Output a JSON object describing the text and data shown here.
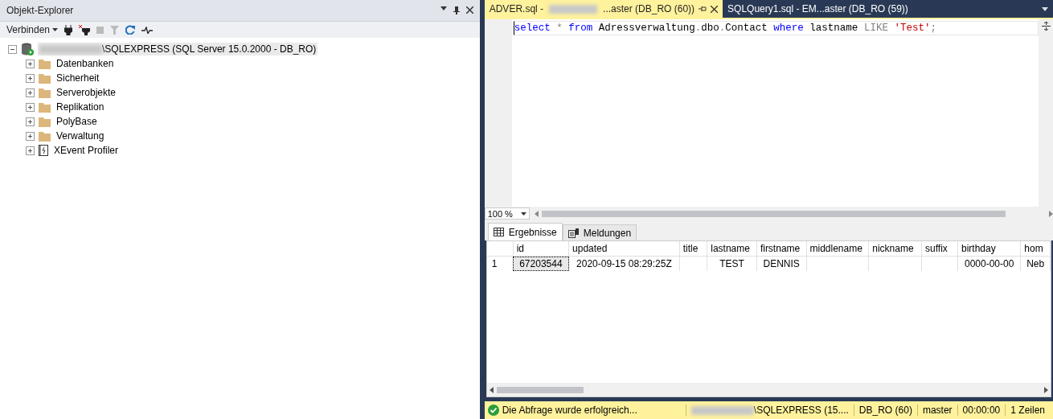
{
  "object_explorer": {
    "title": "Objekt-Explorer",
    "connect_label": "Verbinden",
    "server": {
      "prefix_hidden": true,
      "name": "\\SQLEXPRESS (SQL Server 15.0.2000 - DB_RO)",
      "expanded": true,
      "selected": true,
      "children": [
        {
          "label": "Datenbanken",
          "kind": "folder",
          "expanded": false,
          "selected": false
        },
        {
          "label": "Sicherheit",
          "kind": "folder",
          "expanded": false,
          "selected": false
        },
        {
          "label": "Serverobjekte",
          "kind": "folder",
          "expanded": false,
          "selected": false
        },
        {
          "label": "Replikation",
          "kind": "folder",
          "expanded": false,
          "selected": false
        },
        {
          "label": "PolyBase",
          "kind": "folder",
          "expanded": false,
          "selected": false
        },
        {
          "label": "Verwaltung",
          "kind": "folder",
          "expanded": false,
          "selected": false
        },
        {
          "label": "XEvent Profiler",
          "kind": "profiler",
          "expanded": false,
          "selected": false
        }
      ]
    }
  },
  "editor_tabs": [
    {
      "before": "ADVER.sql -",
      "hidden": true,
      "after": "...aster (DB_RO (60))",
      "selected": true
    },
    {
      "before": "SQLQuery1.sql - EM...aster (DB_RO (59))",
      "hidden": false,
      "selected": false
    }
  ],
  "code": [
    {
      "kind": "keyword",
      "text": "select"
    },
    {
      "kind": "op",
      "text": " * "
    },
    {
      "kind": "keyword",
      "text": "from"
    },
    {
      "kind": "plain",
      "text": " Adressverwaltung"
    },
    {
      "kind": "op",
      "text": "."
    },
    {
      "kind": "plain",
      "text": "dbo"
    },
    {
      "kind": "op",
      "text": "."
    },
    {
      "kind": "plain",
      "text": "Contact "
    },
    {
      "kind": "keyword",
      "text": "where"
    },
    {
      "kind": "plain",
      "text": " lastname "
    },
    {
      "kind": "op",
      "text": "LIKE"
    },
    {
      "kind": "string",
      "text": " 'Test'"
    },
    {
      "kind": "op",
      "text": ";"
    }
  ],
  "zoom": "100 %",
  "result_tabs": [
    {
      "label": "Ergebnisse",
      "kind": "grid",
      "selected": true
    },
    {
      "label": "Meldungen",
      "kind": "messages",
      "selected": false
    }
  ],
  "grid": {
    "columns": [
      "id",
      "updated",
      "title",
      "lastname",
      "firstname",
      "middlename",
      "nickname",
      "suffix",
      "birthday",
      "hom"
    ],
    "rows": [
      {
        "number": "1",
        "cells": [
          "67203544",
          "2020-09-15 08:29:25Z",
          "",
          "TEST",
          "DENNIS",
          "",
          "",
          "",
          "0000-00-00",
          "Neb"
        ]
      }
    ]
  },
  "status_bar": {
    "message": "Die Abfrage wurde erfolgreich...",
    "server": "\\SQLEXPRESS (15....",
    "login": "DB_RO (60)",
    "database": "master",
    "time": "00:00:00",
    "rows": "1 Zeilen"
  }
}
